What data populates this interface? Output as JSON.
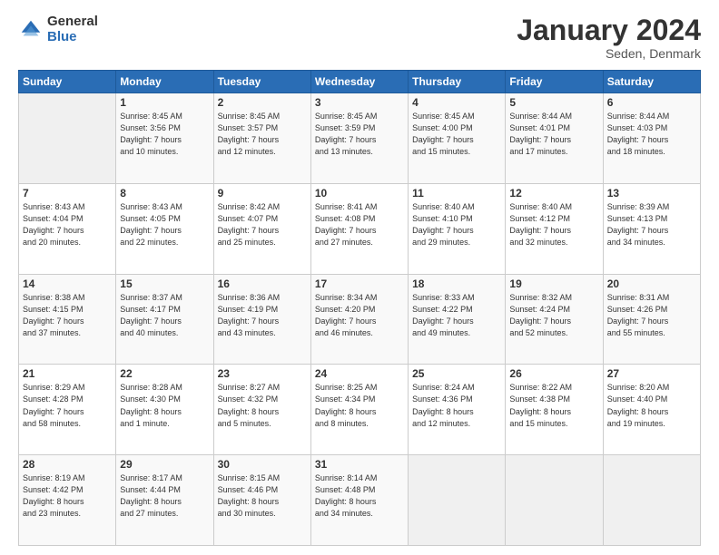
{
  "logo": {
    "general": "General",
    "blue": "Blue"
  },
  "header": {
    "month": "January 2024",
    "location": "Seden, Denmark"
  },
  "weekdays": [
    "Sunday",
    "Monday",
    "Tuesday",
    "Wednesday",
    "Thursday",
    "Friday",
    "Saturday"
  ],
  "weeks": [
    [
      {
        "day": "",
        "info": ""
      },
      {
        "day": "1",
        "info": "Sunrise: 8:45 AM\nSunset: 3:56 PM\nDaylight: 7 hours\nand 10 minutes."
      },
      {
        "day": "2",
        "info": "Sunrise: 8:45 AM\nSunset: 3:57 PM\nDaylight: 7 hours\nand 12 minutes."
      },
      {
        "day": "3",
        "info": "Sunrise: 8:45 AM\nSunset: 3:59 PM\nDaylight: 7 hours\nand 13 minutes."
      },
      {
        "day": "4",
        "info": "Sunrise: 8:45 AM\nSunset: 4:00 PM\nDaylight: 7 hours\nand 15 minutes."
      },
      {
        "day": "5",
        "info": "Sunrise: 8:44 AM\nSunset: 4:01 PM\nDaylight: 7 hours\nand 17 minutes."
      },
      {
        "day": "6",
        "info": "Sunrise: 8:44 AM\nSunset: 4:03 PM\nDaylight: 7 hours\nand 18 minutes."
      }
    ],
    [
      {
        "day": "7",
        "info": "Sunrise: 8:43 AM\nSunset: 4:04 PM\nDaylight: 7 hours\nand 20 minutes."
      },
      {
        "day": "8",
        "info": "Sunrise: 8:43 AM\nSunset: 4:05 PM\nDaylight: 7 hours\nand 22 minutes."
      },
      {
        "day": "9",
        "info": "Sunrise: 8:42 AM\nSunset: 4:07 PM\nDaylight: 7 hours\nand 25 minutes."
      },
      {
        "day": "10",
        "info": "Sunrise: 8:41 AM\nSunset: 4:08 PM\nDaylight: 7 hours\nand 27 minutes."
      },
      {
        "day": "11",
        "info": "Sunrise: 8:40 AM\nSunset: 4:10 PM\nDaylight: 7 hours\nand 29 minutes."
      },
      {
        "day": "12",
        "info": "Sunrise: 8:40 AM\nSunset: 4:12 PM\nDaylight: 7 hours\nand 32 minutes."
      },
      {
        "day": "13",
        "info": "Sunrise: 8:39 AM\nSunset: 4:13 PM\nDaylight: 7 hours\nand 34 minutes."
      }
    ],
    [
      {
        "day": "14",
        "info": "Sunrise: 8:38 AM\nSunset: 4:15 PM\nDaylight: 7 hours\nand 37 minutes."
      },
      {
        "day": "15",
        "info": "Sunrise: 8:37 AM\nSunset: 4:17 PM\nDaylight: 7 hours\nand 40 minutes."
      },
      {
        "day": "16",
        "info": "Sunrise: 8:36 AM\nSunset: 4:19 PM\nDaylight: 7 hours\nand 43 minutes."
      },
      {
        "day": "17",
        "info": "Sunrise: 8:34 AM\nSunset: 4:20 PM\nDaylight: 7 hours\nand 46 minutes."
      },
      {
        "day": "18",
        "info": "Sunrise: 8:33 AM\nSunset: 4:22 PM\nDaylight: 7 hours\nand 49 minutes."
      },
      {
        "day": "19",
        "info": "Sunrise: 8:32 AM\nSunset: 4:24 PM\nDaylight: 7 hours\nand 52 minutes."
      },
      {
        "day": "20",
        "info": "Sunrise: 8:31 AM\nSunset: 4:26 PM\nDaylight: 7 hours\nand 55 minutes."
      }
    ],
    [
      {
        "day": "21",
        "info": "Sunrise: 8:29 AM\nSunset: 4:28 PM\nDaylight: 7 hours\nand 58 minutes."
      },
      {
        "day": "22",
        "info": "Sunrise: 8:28 AM\nSunset: 4:30 PM\nDaylight: 8 hours\nand 1 minute."
      },
      {
        "day": "23",
        "info": "Sunrise: 8:27 AM\nSunset: 4:32 PM\nDaylight: 8 hours\nand 5 minutes."
      },
      {
        "day": "24",
        "info": "Sunrise: 8:25 AM\nSunset: 4:34 PM\nDaylight: 8 hours\nand 8 minutes."
      },
      {
        "day": "25",
        "info": "Sunrise: 8:24 AM\nSunset: 4:36 PM\nDaylight: 8 hours\nand 12 minutes."
      },
      {
        "day": "26",
        "info": "Sunrise: 8:22 AM\nSunset: 4:38 PM\nDaylight: 8 hours\nand 15 minutes."
      },
      {
        "day": "27",
        "info": "Sunrise: 8:20 AM\nSunset: 4:40 PM\nDaylight: 8 hours\nand 19 minutes."
      }
    ],
    [
      {
        "day": "28",
        "info": "Sunrise: 8:19 AM\nSunset: 4:42 PM\nDaylight: 8 hours\nand 23 minutes."
      },
      {
        "day": "29",
        "info": "Sunrise: 8:17 AM\nSunset: 4:44 PM\nDaylight: 8 hours\nand 27 minutes."
      },
      {
        "day": "30",
        "info": "Sunrise: 8:15 AM\nSunset: 4:46 PM\nDaylight: 8 hours\nand 30 minutes."
      },
      {
        "day": "31",
        "info": "Sunrise: 8:14 AM\nSunset: 4:48 PM\nDaylight: 8 hours\nand 34 minutes."
      },
      {
        "day": "",
        "info": ""
      },
      {
        "day": "",
        "info": ""
      },
      {
        "day": "",
        "info": ""
      }
    ]
  ]
}
